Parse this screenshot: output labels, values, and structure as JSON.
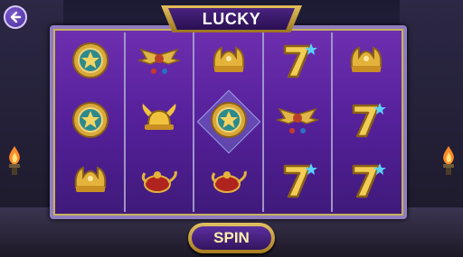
{
  "game": {
    "title": "LUCKY",
    "spin_label": "SPIN"
  },
  "reels": [
    [
      "star-medallion",
      "star-medallion",
      "golden-crown-jewel"
    ],
    [
      "winged-scarab",
      "golden-horned-helmet",
      "ruby-genie-lamp"
    ],
    [
      "golden-crown-jewel",
      "star-medallion",
      "ruby-genie-lamp"
    ],
    [
      "lucky-seven",
      "winged-scarab",
      "lucky-seven"
    ],
    [
      "golden-crown-jewel",
      "lucky-seven",
      "lucky-seven"
    ]
  ],
  "highlighted_cell": {
    "reel": 3,
    "row": 2
  },
  "colors": {
    "reel_bg": "#5a22a0",
    "frame_gold": "#d2ae47",
    "spin_text": "#fff1a8"
  }
}
